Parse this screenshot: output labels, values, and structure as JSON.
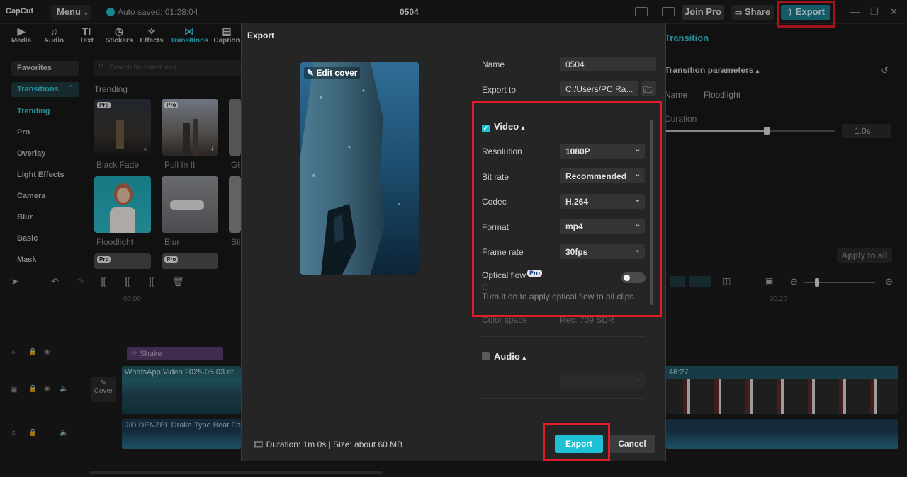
{
  "app": {
    "logo": "CapCut",
    "menu_label": "Menu",
    "autosave": "Auto saved: 01:28:04",
    "project_title": "0504",
    "join_pro": "Join Pro",
    "share": "Share",
    "export": "Export"
  },
  "toolbar": {
    "items": [
      {
        "label": "Media",
        "icon": "media-icon"
      },
      {
        "label": "Audio",
        "icon": "audio-icon"
      },
      {
        "label": "Text",
        "icon": "text-icon"
      },
      {
        "label": "Stickers",
        "icon": "stickers-icon"
      },
      {
        "label": "Effects",
        "icon": "effects-icon"
      },
      {
        "label": "Transitions",
        "icon": "transitions-icon"
      },
      {
        "label": "Caption",
        "icon": "caption-icon"
      }
    ]
  },
  "left_panel": {
    "favorites": "Favorites",
    "transitions_tab": "Transitions",
    "search_placeholder": "Search for transitions",
    "section": "Trending",
    "categories": [
      "Trending",
      "Pro",
      "Overlay",
      "Light Effects",
      "Camera",
      "Blur",
      "Basic",
      "Mask"
    ],
    "thumbs": [
      {
        "label": "Black Fade",
        "pro": "Pro"
      },
      {
        "label": "Pull In II",
        "pro": "Pro"
      },
      {
        "label": "Gl",
        "pro": ""
      },
      {
        "label": "Floodlight",
        "pro": ""
      },
      {
        "label": "Blur",
        "pro": ""
      },
      {
        "label": "Sli",
        "pro": ""
      }
    ],
    "row3_badges": [
      "Pro",
      "Pro"
    ]
  },
  "right_panel": {
    "title": "Transition",
    "params": "Transition parameters",
    "name_label": "Name",
    "name_value": "Floodlight",
    "duration_label": "Duration",
    "duration_value": "1.0s",
    "duration_fraction": 0.6,
    "apply_all": "Apply to all"
  },
  "timeline": {
    "ruler": [
      "00:00",
      "00:20"
    ],
    "effect_clip": "Shake",
    "cover_label": "Cover",
    "video_clip": "WhatsApp Video 2025-05-03 at",
    "video_clip_end": "46:27",
    "audio_clip": "JID DENZEL Drake Type Beat Focu",
    "zoom_fraction": 0.15
  },
  "export_dialog": {
    "title": "Export",
    "edit_cover": "Edit cover",
    "name_label": "Name",
    "name_value": "0504",
    "export_to_label": "Export to",
    "export_to_value": "C:/Users/PC Ra...",
    "video_section": "Video",
    "video_checked": true,
    "resolution_label": "Resolution",
    "resolution": "1080P",
    "bitrate_label": "Bit rate",
    "bitrate": "Recommended",
    "codec_label": "Codec",
    "codec": "H.264",
    "format_label": "Format",
    "format": "mp4",
    "framerate_label": "Frame rate",
    "framerate": "30fps",
    "optical_flow_label": "Optical flow",
    "pro_badge": "Pro",
    "optical_flow_on": false,
    "optical_flow_hint": "Turn it on to apply optical flow to all clips.",
    "color_space_label": "Color space",
    "color_space": "Rec. 709 SDR",
    "audio_section": "Audio",
    "audio_checked": false,
    "footer_info": "Duration: 1m 0s | Size: about 60 MB",
    "export_button": "Export",
    "cancel_button": "Cancel"
  },
  "colors": {
    "accent": "#1ec0d3",
    "highlight_box": "#e21d2a",
    "background": "#181818",
    "modal": "#252526"
  }
}
